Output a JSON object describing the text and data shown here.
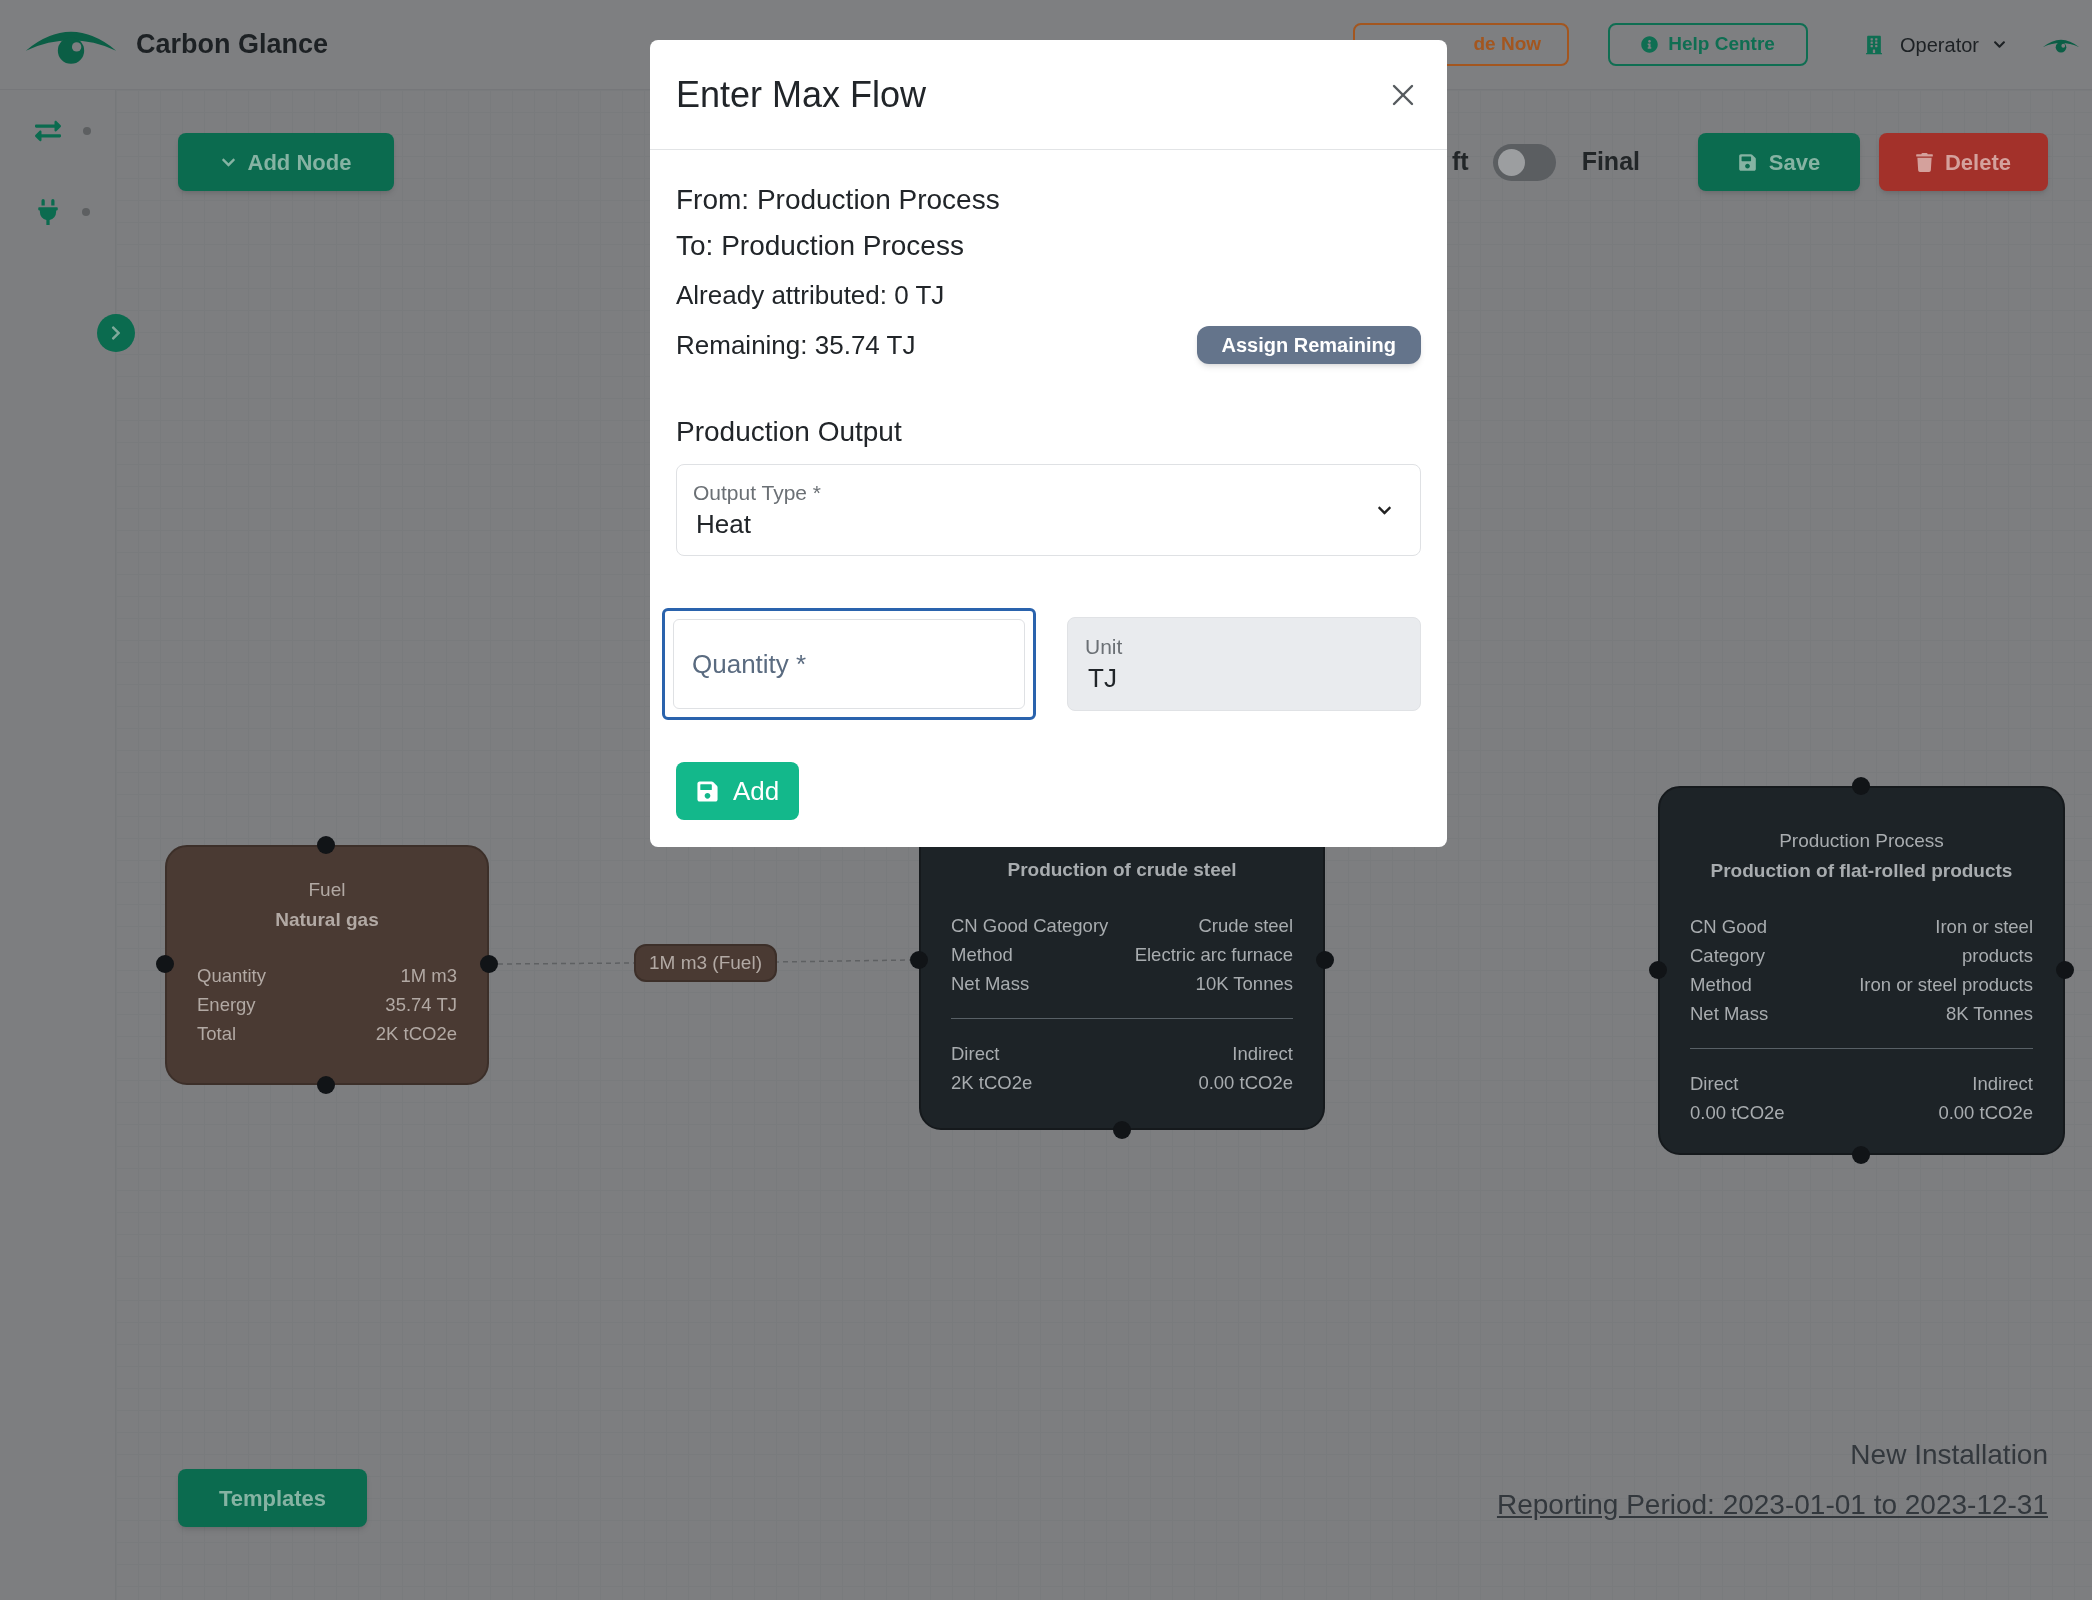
{
  "app": {
    "name": "Carbon Glance"
  },
  "header": {
    "upgrade_button": "de Now",
    "help_button": "Help Centre",
    "user_menu": "Operator"
  },
  "toolbar": {
    "add_node": "Add Node",
    "status_toggle": {
      "left_label": "ft",
      "right_label": "Final",
      "on": false
    },
    "save": "Save",
    "delete": "Delete"
  },
  "canvas": {
    "nodes": [
      {
        "kind": "fuel",
        "type": "Fuel",
        "name": "Natural gas",
        "fields": [
          {
            "label": "Quantity",
            "value": "1M m3"
          },
          {
            "label": "Energy",
            "value": "35.74 TJ"
          },
          {
            "label": "Total",
            "value": "2K tCO2e"
          }
        ]
      },
      {
        "kind": "process",
        "name": "Production of crude steel",
        "fields": [
          {
            "label": "CN Good Category",
            "value": "Crude steel"
          },
          {
            "label": "Method",
            "value": "Electric arc furnace"
          },
          {
            "label": "Net Mass",
            "value": "10K Tonnes"
          }
        ],
        "emissions": [
          {
            "label": "Direct",
            "value": "2K tCO2e"
          },
          {
            "label": "Indirect",
            "value": "0.00 tCO2e"
          }
        ]
      },
      {
        "kind": "process",
        "type": "Production Process",
        "name": "Production of flat-rolled products",
        "fields": [
          {
            "label": "CN Good Category",
            "value": "Iron or steel products"
          },
          {
            "label": "Method",
            "value": "Iron or steel products"
          },
          {
            "label": "Net Mass",
            "value": "8K Tonnes"
          }
        ],
        "emissions": [
          {
            "label": "Direct",
            "value": "0.00 tCO2e"
          },
          {
            "label": "Indirect",
            "value": "0.00 tCO2e"
          }
        ]
      }
    ],
    "edges": [
      {
        "label": "1M m3 (Fuel)"
      }
    ]
  },
  "templates_button": "Templates",
  "installation": {
    "name": "New Installation",
    "reporting_period": "Reporting Period: 2023-01-01 to 2023-12-31"
  },
  "dialog": {
    "title": "Enter Max Flow",
    "from": "From: Production Process",
    "to": "To: Production Process",
    "attributed": "Already attributed: 0 TJ",
    "remaining": "Remaining: 35.74 TJ",
    "assign_button": "Assign Remaining",
    "section": "Production Output",
    "output_type": {
      "label": "Output Type *",
      "value": "Heat"
    },
    "quantity": {
      "placeholder": "Quantity *",
      "focused": true
    },
    "unit": {
      "label": "Unit",
      "value": "TJ"
    },
    "add_button": "Add"
  }
}
